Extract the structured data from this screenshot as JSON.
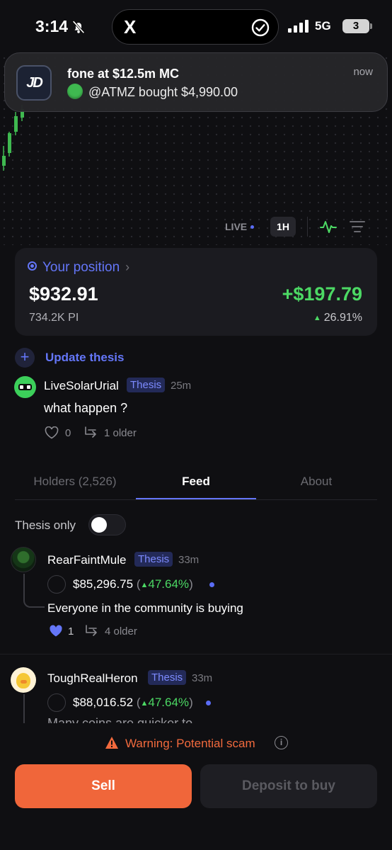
{
  "status_bar": {
    "time": "3:14",
    "island_app": "X",
    "network": "5G",
    "battery": "3",
    "icons": [
      "bell-slash-icon",
      "x-logo-icon",
      "check-circle-icon",
      "signal-icon",
      "battery-icon"
    ]
  },
  "notification": {
    "title": "fone at $12.5m MC",
    "body": "@ATMZ bought $4,990.00",
    "time": "now",
    "icon": "app-logo-icon"
  },
  "chart_controls": {
    "live": "LIVE",
    "interval": "1H",
    "icons": [
      "pulse-chart-icon",
      "filter-lines-icon"
    ]
  },
  "position": {
    "label": "Your position",
    "value": "$932.91",
    "amount": "734.2K PI",
    "pnl": "+$197.79",
    "pnl_pct": "26.91%"
  },
  "update_thesis": {
    "label": "Update thesis",
    "icon": "plus-icon"
  },
  "thesis_post": {
    "user": "LiveSolarUrial",
    "badge": "Thesis",
    "time": "25m",
    "message": "what happen ?",
    "likes": "0",
    "older": "1 older"
  },
  "tabs": [
    {
      "label": "Holders (2,526)",
      "active": false
    },
    {
      "label": "Feed",
      "active": true
    },
    {
      "label": "About",
      "active": false
    }
  ],
  "filter": {
    "label": "Thesis only",
    "on": false
  },
  "feed": [
    {
      "user": "RearFaintMule",
      "badge": "Thesis",
      "time": "33m",
      "holding": "$85,296.75",
      "gain": "47.64%",
      "message": "Everyone in the community is buying",
      "likes": "1",
      "older": "4 older"
    },
    {
      "user": "ToughRealHeron",
      "badge": "Thesis",
      "time": "33m",
      "holding": "$88,016.52",
      "gain": "47.64%",
      "message": "Many coins are quicker to"
    }
  ],
  "warning": {
    "text": "Warning: Potential scam",
    "icon": "warning-triangle-icon"
  },
  "actions": {
    "sell": "Sell",
    "deposit": "Deposit to buy"
  },
  "colors": {
    "accent": "#6476f8",
    "positive": "#4cd964",
    "sell": "#f0663a",
    "background": "#0f0f12"
  }
}
